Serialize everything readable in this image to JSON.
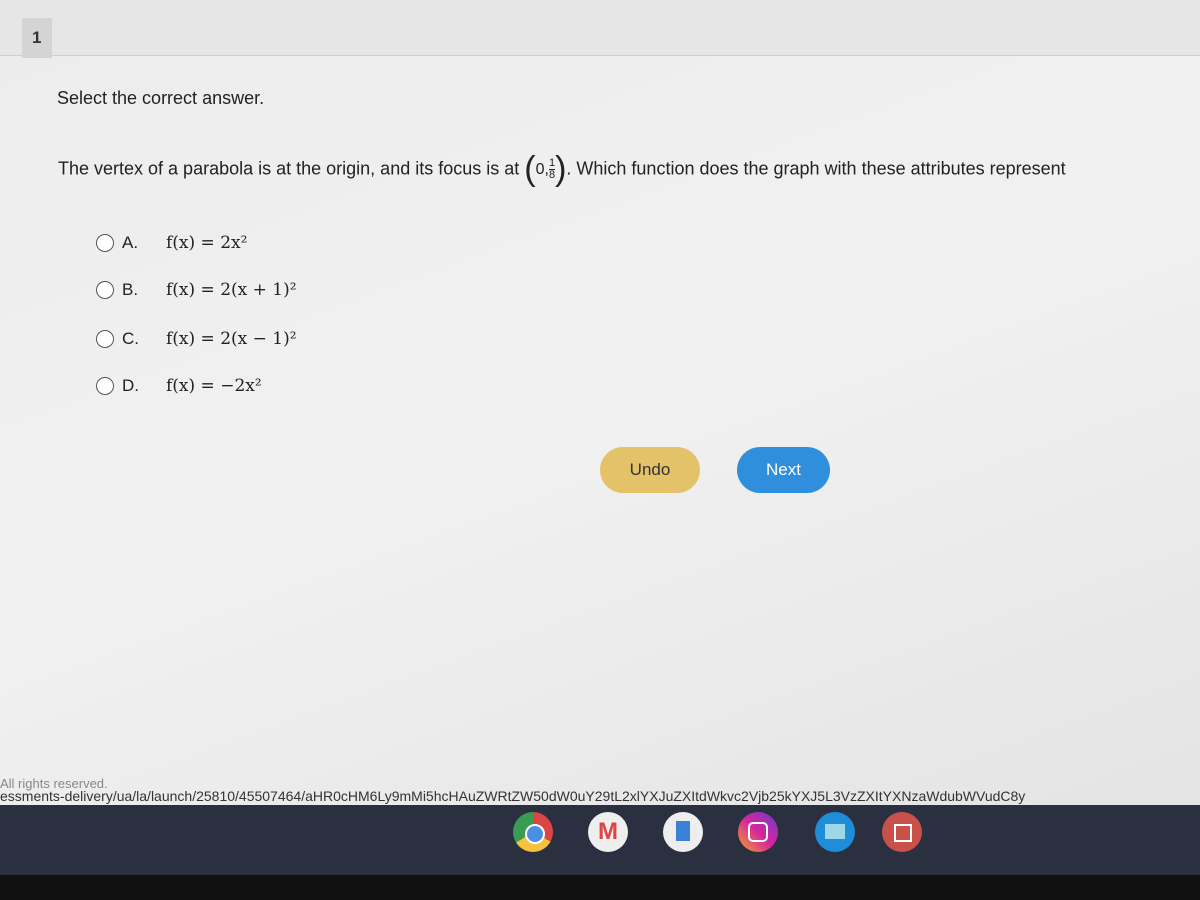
{
  "question_number": "1",
  "instruction": "Select the correct answer.",
  "question": {
    "before": "The vertex of a parabola is at the origin, and its focus is at",
    "point_x": "0",
    "point_y_num": "1",
    "point_y_den": "8",
    "after": ". Which function does the graph with these attributes represent"
  },
  "options": [
    {
      "label": "A.",
      "formula": "f(x) = 2x²"
    },
    {
      "label": "B.",
      "formula": "f(x) = 2(x + 1)²"
    },
    {
      "label": "C.",
      "formula": "f(x) = 2(x − 1)²"
    },
    {
      "label": "D.",
      "formula": "f(x) = −2x²"
    }
  ],
  "buttons": {
    "undo": "Undo",
    "next": "Next"
  },
  "footer": {
    "rights": "All rights reserved.",
    "url": "essments-delivery/ua/la/launch/25810/45507464/aHR0cHM6Ly9mMi5hcHAuZWRtZW50dW0uY29tL2xlYXJuZXItdWkvc2Vjb25kYXJ5L3VzZXItYXNzaWdubWVudC8y"
  },
  "shelf_apps": [
    "chrome-icon",
    "gmail-icon",
    "docs-icon",
    "instagram-icon",
    "files-icon",
    "gallery-icon"
  ]
}
